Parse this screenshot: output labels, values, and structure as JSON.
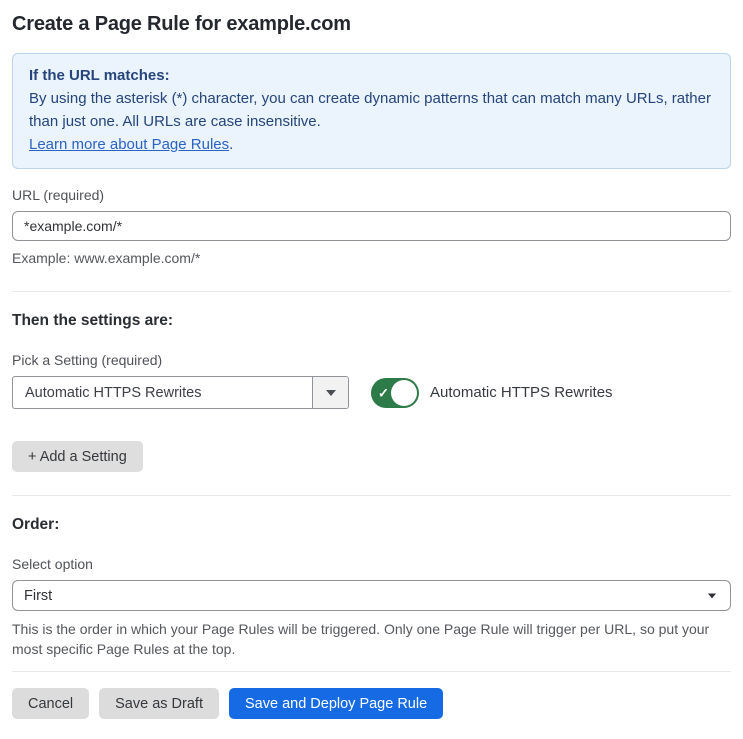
{
  "page": {
    "title": "Create a Page Rule for example.com"
  },
  "info_box": {
    "heading": "If the URL matches:",
    "body": "By using the asterisk (*) character, you can create dynamic patterns that can match many URLs, rather than just one. All URLs are case insensitive.",
    "link": "Learn more about Page Rules",
    "link_suffix": "."
  },
  "url_field": {
    "label": "URL (required)",
    "value": "*example.com/*",
    "helper": "Example: www.example.com/*"
  },
  "settings_section": {
    "heading": "Then the settings are:",
    "picker_label": "Pick a Setting (required)",
    "picker_value": "Automatic HTTPS Rewrites",
    "toggle_state": "on",
    "toggle_check_glyph": "✓",
    "toggle_label": "Automatic HTTPS Rewrites",
    "add_button_label": "+ Add a Setting"
  },
  "order_section": {
    "heading": "Order:",
    "select_label": "Select option",
    "select_value": "First",
    "helper": "This is the order in which your Page Rules will be triggered. Only one Page Rule will trigger per URL, so put your most specific Page Rules at the top."
  },
  "footer": {
    "cancel_label": "Cancel",
    "save_draft_label": "Save as Draft",
    "save_deploy_label": "Save and Deploy Page Rule"
  },
  "colors": {
    "accent_blue": "#166be4",
    "toggle_green": "#2c7b48",
    "info_box_bg": "#ebf3fc",
    "info_box_border": "#b9d3f0",
    "info_text": "#25457c",
    "link_blue": "#2b63c6",
    "gray_button_bg": "#dcdcdc",
    "divider": "#e9e9ea"
  }
}
